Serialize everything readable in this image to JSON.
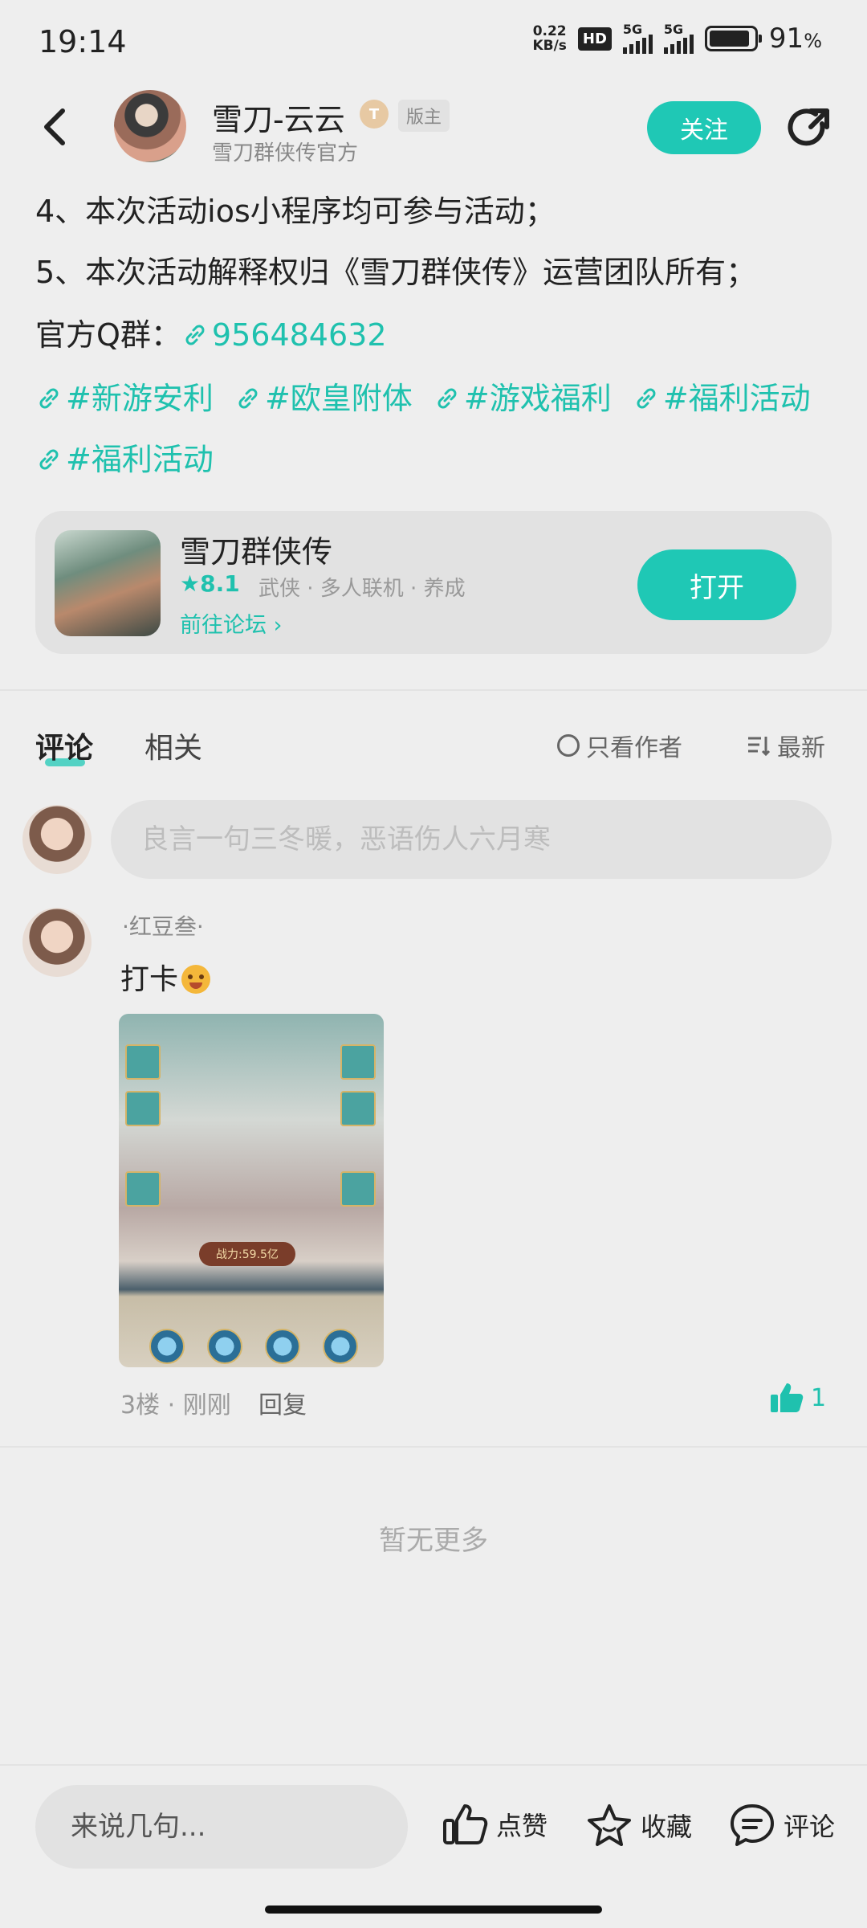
{
  "status_bar": {
    "time": "19:14",
    "net_speed_value": "0.22",
    "net_speed_unit": "KB/s",
    "hd_label": "HD",
    "sim1_label": "5G",
    "sim2_label": "5G",
    "battery_percent": "91",
    "battery_symbol": "%"
  },
  "header": {
    "author_name": "雪刀-云云",
    "level_badge": "T",
    "role_badge": "版主",
    "author_subtitle": "雪刀群侠传官方",
    "follow_label": "关注"
  },
  "post": {
    "line4": "4、本次活动ios小程序均可参与活动；",
    "line5": "5、本次活动解释权归《雪刀群侠传》运营团队所有；",
    "qq_label": "官方Q群：",
    "qq_number": "956484632",
    "tags": [
      "#新游安利",
      "#欧皇附体",
      "#游戏福利",
      "#福利活动",
      "#福利活动"
    ]
  },
  "game_card": {
    "name": "雪刀群侠传",
    "rating": "8.1",
    "genre_tags": "武侠 · 多人联机 · 养成",
    "forum_link": "前往论坛",
    "open_label": "打开"
  },
  "comments_section": {
    "tab_comment": "评论",
    "tab_related": "相关",
    "author_only": "只看作者",
    "sort_label": "最新",
    "input_placeholder": "良言一句三冬暖，恶语伤人六月寒"
  },
  "comment": {
    "username": "·红豆叁·",
    "text": "打卡",
    "image_power": "战力:59.5亿",
    "floor": "3楼",
    "time": "刚刚",
    "reply_label": "回复",
    "like_count": "1"
  },
  "footer": {
    "no_more": "暂无更多",
    "input_placeholder": "来说几句...",
    "like_label": "点赞",
    "favorite_label": "收藏",
    "comment_label": "评论"
  },
  "colors": {
    "accent": "#1fc8b5",
    "link": "#1fc1ae",
    "background": "#eeeeee"
  }
}
